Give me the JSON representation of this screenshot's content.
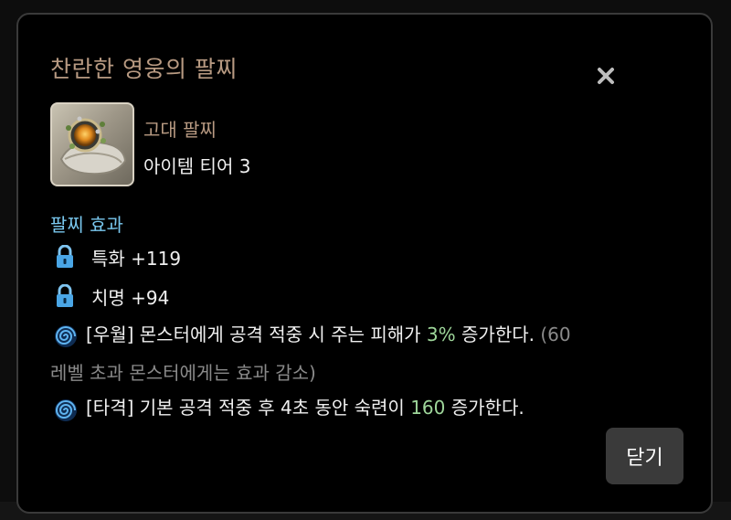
{
  "tooltip": {
    "title": "찬란한 영웅의 팔찌",
    "item_type": "고대 팔찌",
    "item_tier": "아이템 티어 3",
    "section_title": "팔찌 효과",
    "stats": [
      {
        "label": "특화 +119",
        "icon": "lock-icon"
      },
      {
        "label": "치명 +94",
        "icon": "lock-icon"
      }
    ],
    "effects": [
      {
        "icon": "spiral-icon",
        "line1_pre": "[우월] 몬스터에게 공격 적중 시 주는 피해가 ",
        "line1_value": "3%",
        "line1_post": " 증가한다. ",
        "line1_note": "(60",
        "line2_note": "레벨 초과 몬스터에게는 효과 감소)"
      },
      {
        "icon": "spiral-icon",
        "line1_pre": "[타격] 기본 공격 적중 후 4초 동안 숙련이 ",
        "line1_value": "160",
        "line1_post": " 증가한다."
      }
    ],
    "close_button_label": "닫기"
  },
  "colors": {
    "title": "#b89a82",
    "section": "#79c7ee",
    "highlight": "#9ed69a",
    "note": "#8a8a8a",
    "button_bg": "#3a3a3a"
  }
}
